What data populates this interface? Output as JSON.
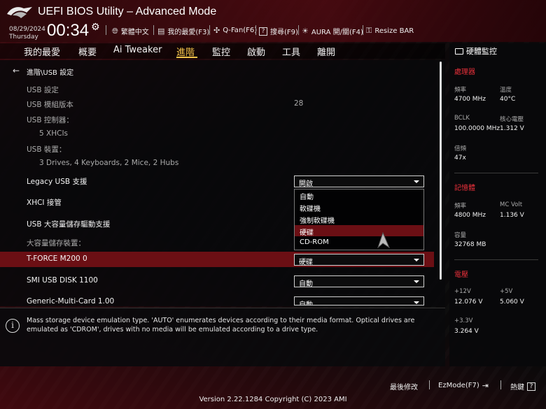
{
  "header": {
    "title": "UEFI BIOS Utility – Advanced Mode",
    "date": "08/29/2024",
    "day": "Thursday",
    "time": "00:34",
    "tools": [
      {
        "icon": "globe-icon",
        "label": "繁體中文"
      },
      {
        "icon": "favorite-icon",
        "label": "我的最愛(F3)"
      },
      {
        "icon": "fan-icon",
        "label": "Q-Fan(F6)"
      },
      {
        "icon": "help-icon",
        "label": "搜尋(F9)"
      },
      {
        "icon": "aura-icon",
        "label": "AURA 開/關(F4)"
      },
      {
        "icon": "resize-bar-icon",
        "label": "Resize BAR"
      }
    ]
  },
  "nav": {
    "tabs": [
      "我的最愛",
      "概要",
      "Ai Tweaker",
      "進階",
      "監控",
      "啟動",
      "工具",
      "離開"
    ],
    "active": "進階"
  },
  "main": {
    "breadcrumb": "進階\\USB 設定",
    "usb_settings": "USB 設定",
    "module_version_label": "USB 模組版本",
    "module_version_value": "28",
    "controllers_label": "USB 控制器：",
    "controllers_value": "5 XHCIs",
    "devices_label": "USB 裝置：",
    "devices_value": "3 Drives, 4 Keyboards, 2 Mice, 2 Hubs",
    "legacy_label": "Legacy USB 支援",
    "legacy_value": "開啟",
    "xhci_label": "XHCI 接管",
    "mass_storage_label": "USB 大容量儲存驅動支援",
    "mass_devices_label": "大容量儲存裝置：",
    "device1_label": "T-FORCE M200 0",
    "device1_value": "硬碟",
    "device2_label": "SMI USB DISK 1100",
    "device2_value": "自動",
    "device3_label": "Generic-Multi-Card 1.00",
    "device3_value": "自動",
    "popup_options": [
      "自動",
      "軟碟機",
      "強制軟碟機",
      "硬碟",
      "CD-ROM"
    ],
    "popup_selected": "硬碟"
  },
  "help": {
    "text": "Mass storage device emulation type. 'AUTO' enumerates devices according to their media format. Optical drives are emulated as 'CDROM', drives with no media will be emulated according to a drive type."
  },
  "hw_monitor": {
    "title": "硬體監控",
    "processor": {
      "heading": "處理器",
      "freq_label": "頻率",
      "freq_value": "4700 MHz",
      "temp_label": "溫度",
      "temp_value": "40°C",
      "bclk_label": "BCLK",
      "bclk_value": "100.0000 MHz",
      "vcore_label": "核心電壓",
      "vcore_value": "1.312 V",
      "ratio_label": "倍頻",
      "ratio_value": "47x"
    },
    "memory": {
      "heading": "記憶體",
      "freq_label": "頻率",
      "freq_value": "4800 MHz",
      "volt_label": "MC Volt",
      "volt_value": "1.136 V",
      "cap_label": "容量",
      "cap_value": "32768 MB"
    },
    "voltage": {
      "heading": "電壓",
      "v12_label": "+12V",
      "v12_value": "12.076 V",
      "v5_label": "+5V",
      "v5_value": "5.060 V",
      "v33_label": "+3.3V",
      "v33_value": "3.264 V"
    }
  },
  "footer": {
    "last_modified": "最後修改",
    "ezmode": "EzMode(F7)",
    "hotkeys": "熱鍵",
    "hotkeys_key": "?",
    "version": "Version 2.22.1284 Copyright (C) 2023 AMI"
  }
}
